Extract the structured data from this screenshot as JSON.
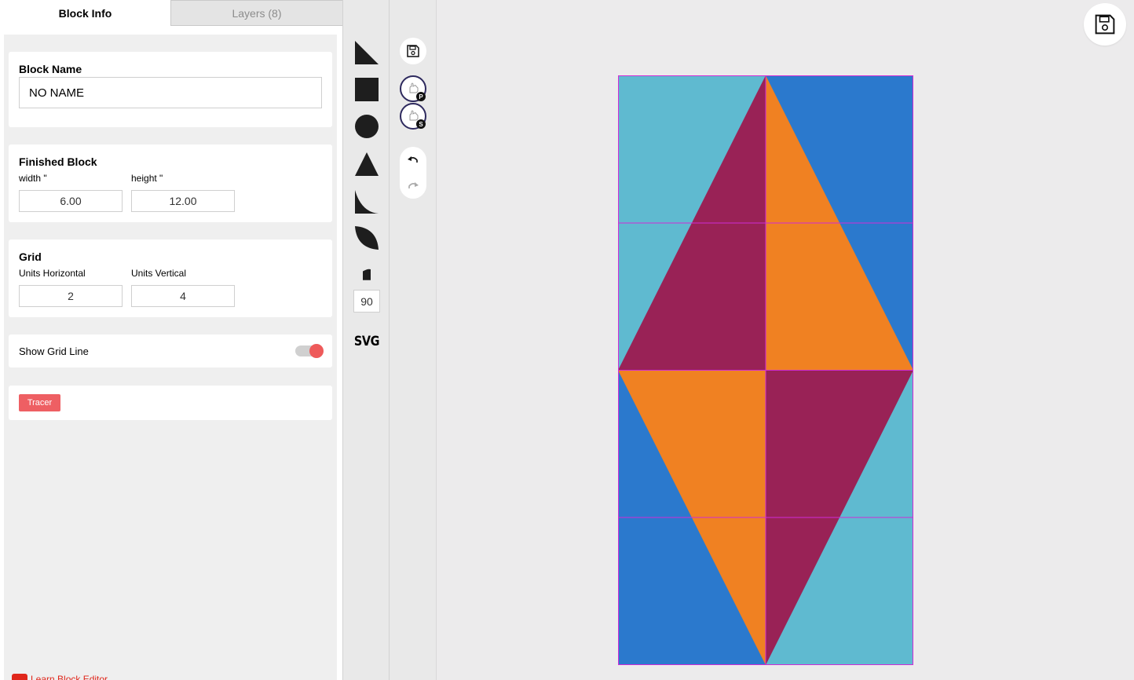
{
  "tabs": [
    {
      "label": "Block Info",
      "active": true
    },
    {
      "label": "Layers (8)",
      "active": false
    }
  ],
  "block_name": {
    "label": "Block Name",
    "value": "NO NAME"
  },
  "finished_block": {
    "title": "Finished Block",
    "width_label": "width \"",
    "width_value": "6.00",
    "height_label": "height \"",
    "height_value": "12.00"
  },
  "grid": {
    "title": "Grid",
    "horizontal_label": "Units Horizontal",
    "horizontal_value": "2",
    "vertical_label": "Units Vertical",
    "vertical_value": "4"
  },
  "grid_line": {
    "label": "Show Grid Line",
    "enabled": true
  },
  "tracer": {
    "label": "Tracer"
  },
  "learn_link": {
    "label": "Learn Block Editor"
  },
  "shapes": {
    "icons": [
      "half-square-triangle-icon",
      "square-icon",
      "circle-icon",
      "triangle-icon",
      "quarter-arc-icon",
      "leaf-icon",
      "wedge-icon"
    ],
    "angle_value": "90",
    "svg_label": "SVG"
  },
  "tools": {
    "icons": [
      "save-icon",
      "palette-primary-icon",
      "palette-secondary-icon",
      "undo-icon",
      "redo-icon"
    ],
    "palette_primary_badge": "P",
    "palette_secondary_badge": "S"
  },
  "block": {
    "colors": {
      "light_blue": "#5fbad0",
      "blue": "#2b79cd",
      "plum": "#992256",
      "orange": "#f08122",
      "grid_line": "#d02cd6"
    }
  }
}
